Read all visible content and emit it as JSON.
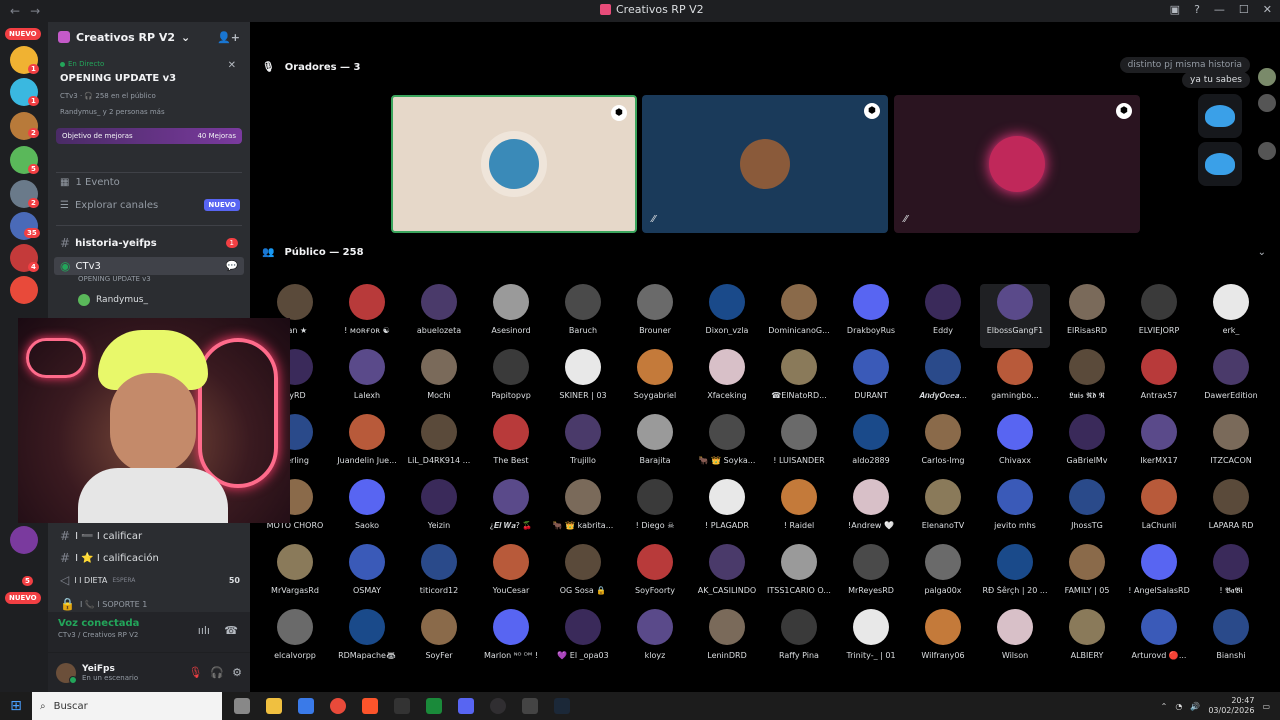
{
  "titlebar": {
    "title": "Creativos RP V2"
  },
  "rail": {
    "nuevo_top": "NUEVO",
    "nuevo_bottom": "NUEVO",
    "badges": [
      "1",
      "1",
      "2",
      "5",
      "2",
      "35",
      "4",
      "5"
    ]
  },
  "sidebar": {
    "server_name": "Creativos RP V2",
    "live": {
      "tag": "En Directo",
      "title": "OPENING UPDATE v3",
      "meta": "CTv3 · 🎧 258 en el público",
      "users": "Randymus_ y 2 personas más"
    },
    "boost": {
      "label": "Objetivo de mejoras",
      "count": "40 Mejoras"
    },
    "events": "1 Evento",
    "explore": "Explorar canales",
    "explore_badge": "NUEVO",
    "channels": [
      {
        "name": "historia-yeifps",
        "badge": "1"
      },
      {
        "name": "CTv3",
        "sub": "OPENING UPDATE v3",
        "user": "Randymus_"
      }
    ],
    "lower_channels": [
      "I ➖ I calificar",
      "I ⭐ I calificación",
      "I I DIETA",
      "I 📞 I SOPORTE 1"
    ],
    "espera": "ESPERA",
    "dieta_count": "50",
    "voice": {
      "status": "Voz conectada",
      "sub": "CTv3 / Creativos RP V2"
    },
    "user": {
      "name": "YeiFps",
      "status": "En un escenario"
    }
  },
  "main": {
    "speakers_label": "Oradores — 3",
    "public_label": "Público — 258",
    "chat": [
      "distinto pj misma historia",
      "ya tu sabes"
    ]
  },
  "members": [
    [
      "yan ★",
      "! ᴍᴏʀғᴏʀ ☯",
      "abuelozeta",
      "Asesinord",
      "Baruch",
      "Brouner",
      "Dixon_vzla",
      "DominicanoG...",
      "DrakboyRus",
      "Eddy",
      "ElbossGangF1",
      "ElRisasRD",
      "ELVIEJORP",
      "erk_"
    ],
    [
      "oyRD",
      "Lalexh",
      "Mochi",
      "Papitopvp",
      "SKINER | 03",
      "Soygabriel",
      "Xfaceking",
      "☎ElNatoRD...",
      "DURANT",
      "𝑨𝒏𝒅𝒚𝑶𝒄𝒆𝒂...",
      "gamingbo...",
      "𝕷𝖚𝖎𝖘 𝕽𝖉 𝕽",
      "Antrax57",
      "DawerEdition"
    ],
    [
      "herling",
      "Juandelin Jue...",
      "LiL_D4RK914 ...",
      "The Best",
      "Trujillo",
      "Barajita",
      "🐂 👑 Soyka...",
      "! LUISANDER",
      "aldo2889",
      "Carlos-lmg",
      "Chivaxx",
      "GaBrielMv",
      "IkerMX17",
      "ITZCACON"
    ],
    [
      "MOTO CHORO",
      "Saoko",
      "Yeizin",
      "¿𝑬𝒍 𝑾𝒂? 🍒",
      "🐂 👑 kabrita...",
      "! Diego ☠",
      "! PLAGADR",
      "! Raidel",
      "!Andrew 🤍",
      "ElenanoTV",
      "jevito mhs",
      "JhossTG",
      "LaChunli",
      "LAPARA RD"
    ],
    [
      "MrVargasRd",
      "OSMAY",
      "titicord12",
      "YouCesar",
      "OG Sosa 🔒",
      "SoyFoorty",
      "AK_CASILINDO",
      "ITSS1CARIO O...",
      "MrReyesRD",
      "palga00x",
      "RÐ Šêrçh | 20 ...",
      "FAMILY | 05",
      "! AngelSalasRD",
      "! 𝕭𝖆𝕭𝖎"
    ],
    [
      "elcalvorpp",
      "RDMapache🦝",
      "SoyFer",
      "Marlon ᴺᴼ ᴰᴹ !",
      "💜 El _opa03",
      "kloyz",
      "LeninDRD",
      "Raffy Pina",
      "Trinity-_ | 01",
      "Wilfrany06",
      "Wilson",
      "ALBIERY",
      "Arturovd 🔴...",
      "Bianshi"
    ]
  ],
  "taskbar": {
    "search": "Buscar",
    "time": "20:47",
    "date": "03/02/2026"
  }
}
